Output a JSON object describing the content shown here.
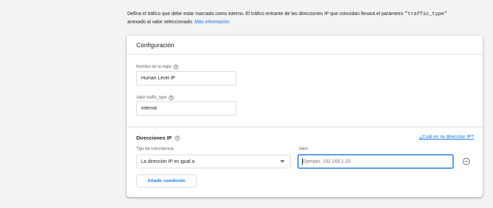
{
  "intro": {
    "line1": "Defina el tráfico que debe estar marcado como interno. El tráfico entrante de las direcciones IP que coincidan llevará el parámetro ",
    "param": "\"traffic_type\"",
    "line2": "anexado al valor seleccionado. ",
    "link": "Más información"
  },
  "card": {
    "title": "Configuración",
    "rule_name": {
      "label": "Nombre de la regla",
      "value": "Human Level IP"
    },
    "traffic_type": {
      "label": "Valor traffic_type",
      "value": "internal"
    },
    "ip_addresses": {
      "title": "Direcciones IP",
      "help_link": "¿Cuál es mi dirección IP?",
      "match_type_label": "Tipo de coincidencia",
      "match_type_value": "La dirección IP es igual a",
      "value_label": "Valor",
      "value_placeholder": "Ejemplo: 192.168.1.20",
      "add_condition": "Añadir condición"
    }
  },
  "icons": {
    "help": "help-circle-icon",
    "dropdown": "arrow-drop-down-icon",
    "remove": "remove-circle-outline-icon"
  },
  "colors": {
    "background": "#f1f3f4",
    "card": "#ffffff",
    "text": "#202124",
    "secondary_text": "#5f6368",
    "accent": "#1a73e8",
    "border": "#dadce0"
  }
}
